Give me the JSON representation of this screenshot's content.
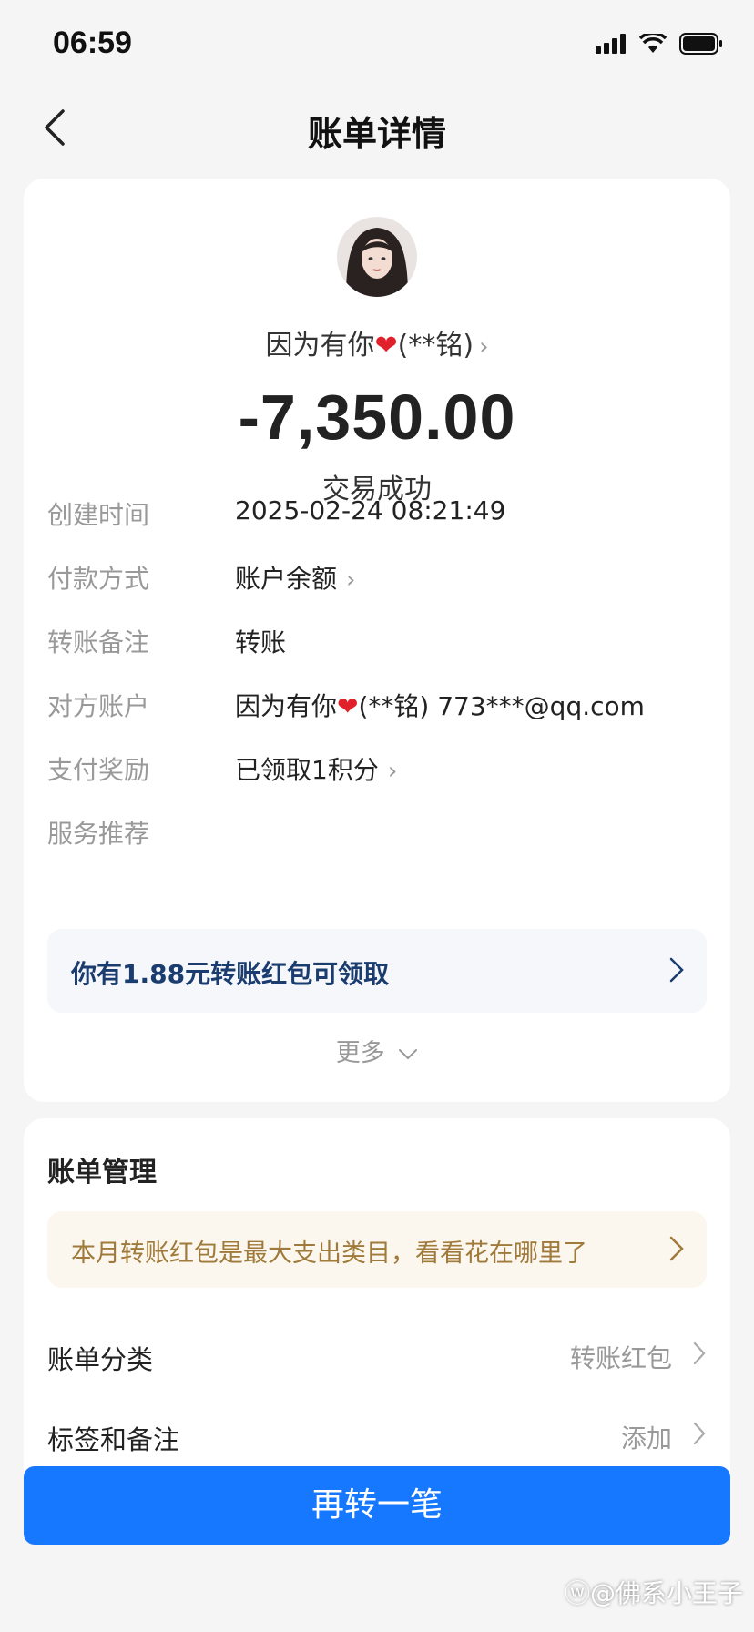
{
  "status_bar": {
    "time": "06:59"
  },
  "nav": {
    "title": "账单详情"
  },
  "transaction": {
    "payee_name": "因为有你",
    "payee_masked": "(**铭)",
    "amount": "-7,350.00",
    "status": "交易成功"
  },
  "details": [
    {
      "label": "创建时间",
      "value": "2025-02-24 08:21:49",
      "link": false
    },
    {
      "label": "付款方式",
      "value": "账户余额",
      "link": true
    },
    {
      "label": "转账备注",
      "value": "转账",
      "link": false
    },
    {
      "label": "对方账户",
      "value": "因为有你",
      "value_suffix": "(**铭) 773***@qq.com",
      "link": false
    },
    {
      "label": "支付奖励",
      "value": "已领取1积分",
      "link": true
    },
    {
      "label": "服务推荐",
      "value": "",
      "link": false
    }
  ],
  "promo": {
    "text": "你有1.88元转账红包可领取"
  },
  "more": {
    "label": "更多"
  },
  "manage": {
    "title": "账单管理",
    "insight": "本月转账红包是最大支出类目，看看花在哪里了",
    "rows": [
      {
        "label": "账单分类",
        "value": "转账红包"
      },
      {
        "label": "标签和备注",
        "value": "添加"
      }
    ]
  },
  "action": {
    "label": "再转一笔"
  },
  "watermark": "@佛系小王子",
  "colors": {
    "primary_button": "#1677ff",
    "heart": "#e0202a",
    "insight_text": "#a07a3a",
    "promo_text": "#1a3c6e"
  },
  "icons": [
    "signal-icon",
    "wifi-icon",
    "battery-icon",
    "back-arrow-icon",
    "heart-icon",
    "chevron-right-icon",
    "chevron-down-icon",
    "weibo-logo-icon"
  ]
}
